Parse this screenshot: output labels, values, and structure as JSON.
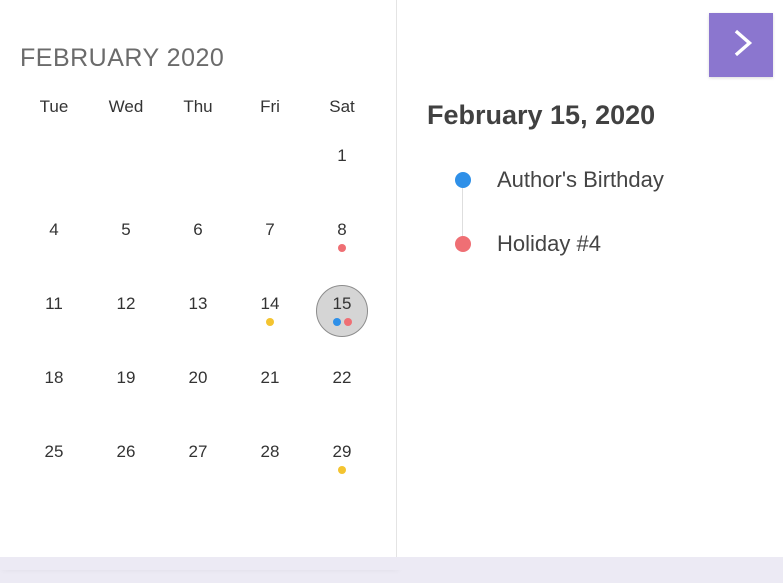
{
  "calendar": {
    "month_title": "FEBRUARY 2020",
    "weekdays": [
      "Tue",
      "Wed",
      "Thu",
      "Fri",
      "Sat"
    ],
    "selected_day": 15,
    "days": [
      {
        "n": null
      },
      {
        "n": null
      },
      {
        "n": null
      },
      {
        "n": null
      },
      {
        "n": 1
      },
      {
        "n": 4
      },
      {
        "n": 5
      },
      {
        "n": 6
      },
      {
        "n": 7
      },
      {
        "n": 8,
        "dots": [
          "red"
        ]
      },
      {
        "n": 11
      },
      {
        "n": 12
      },
      {
        "n": 13
      },
      {
        "n": 14,
        "dots": [
          "yellow"
        ]
      },
      {
        "n": 15,
        "dots": [
          "blue",
          "red"
        ],
        "selected": true
      },
      {
        "n": 18
      },
      {
        "n": 19
      },
      {
        "n": 20
      },
      {
        "n": 21
      },
      {
        "n": 22
      },
      {
        "n": 25
      },
      {
        "n": 26
      },
      {
        "n": 27
      },
      {
        "n": 28
      },
      {
        "n": 29,
        "dots": [
          "yellow"
        ]
      }
    ]
  },
  "detail": {
    "date_label": "February 15, 2020",
    "events": [
      {
        "color": "blue",
        "title": "Author's Birthday"
      },
      {
        "color": "red",
        "title": "Holiday #4"
      }
    ]
  },
  "nav": {
    "next_icon": "chevron-right"
  }
}
